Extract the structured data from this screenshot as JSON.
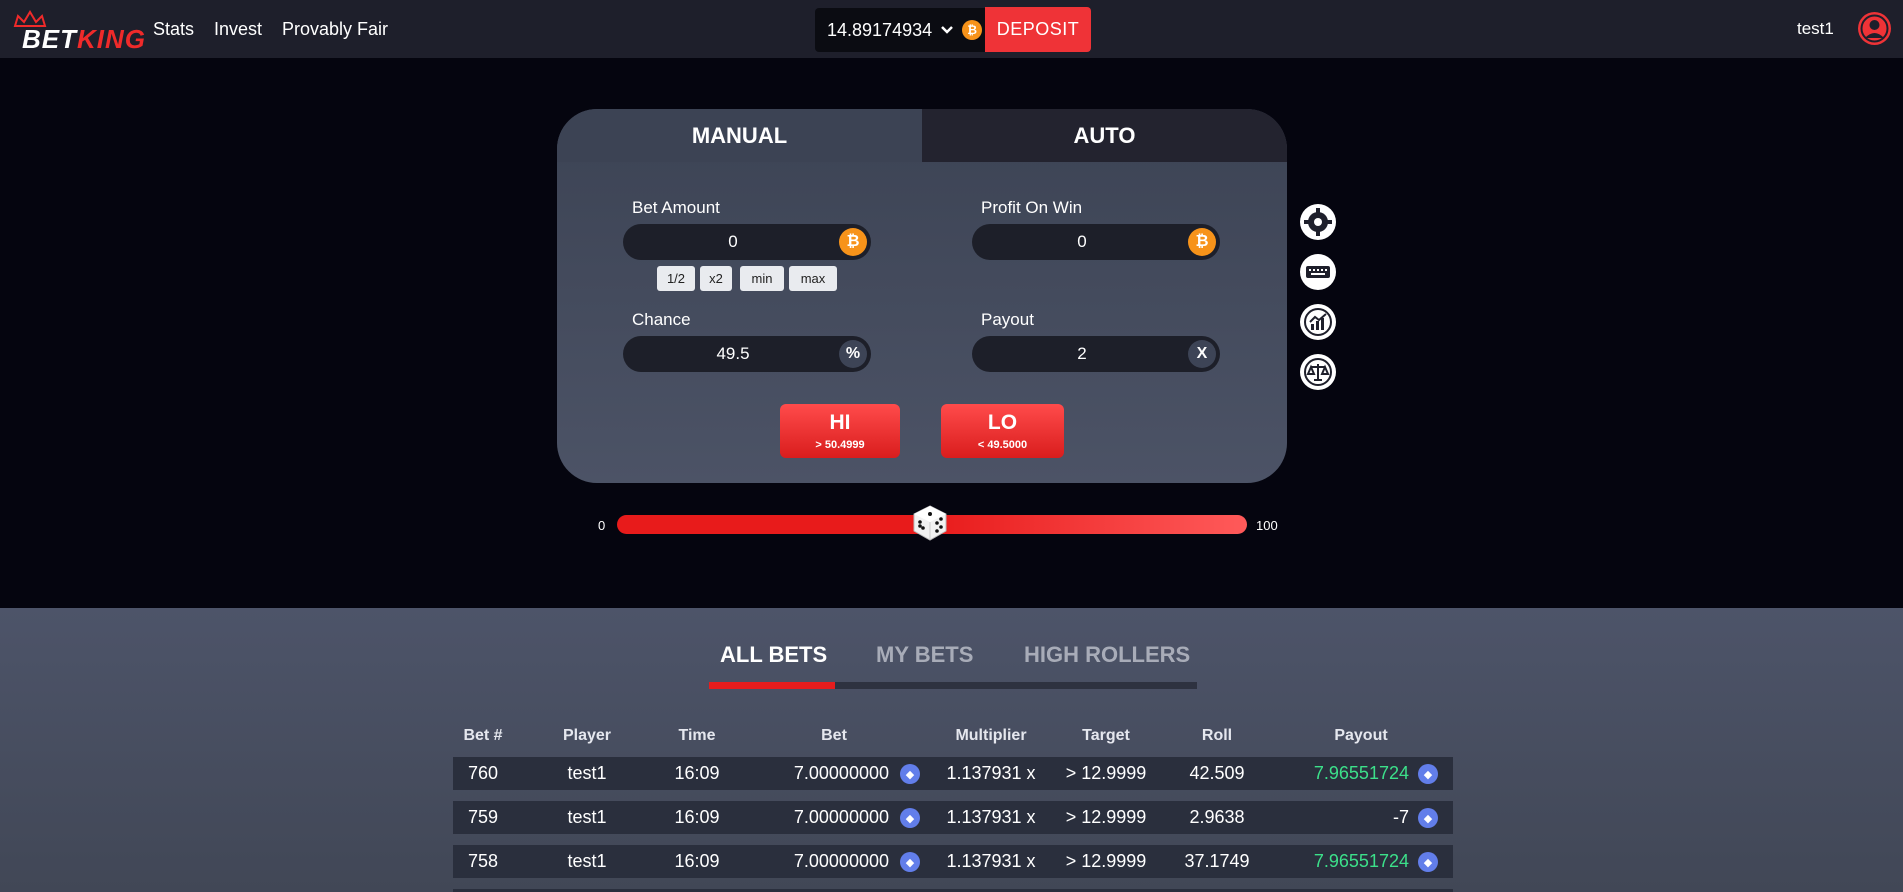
{
  "header": {
    "logo_bet": "BET",
    "logo_king": "KING",
    "nav": [
      "Stats",
      "Invest",
      "Provably Fair"
    ],
    "balance": "14.89174934",
    "currency_icon": "bitcoin-icon",
    "deposit_label": "DEPOSIT",
    "username": "test1"
  },
  "game": {
    "tabs": [
      {
        "label": "MANUAL",
        "active": true
      },
      {
        "label": "AUTO",
        "active": false
      }
    ],
    "bet_amount": {
      "label": "Bet Amount",
      "value": "0"
    },
    "profit_on_win": {
      "label": "Profit On Win",
      "value": "0"
    },
    "quick_buttons": [
      "1/2",
      "x2",
      "min",
      "max"
    ],
    "chance": {
      "label": "Chance",
      "value": "49.5",
      "suffix": "%"
    },
    "payout": {
      "label": "Payout",
      "value": "2",
      "suffix": "X"
    },
    "hi": {
      "label": "HI",
      "sub": "> 50.4999"
    },
    "lo": {
      "label": "LO",
      "sub": "< 49.5000"
    },
    "side_icons": [
      "gear-icon",
      "keyboard-icon",
      "chart-icon",
      "balance-scale-icon"
    ]
  },
  "slider": {
    "min": "0",
    "max": "100",
    "value": 50
  },
  "bets": {
    "tabs": [
      "ALL BETS",
      "MY BETS",
      "HIGH ROLLERS"
    ],
    "active_tab": "ALL BETS",
    "columns": [
      "Bet #",
      "Player",
      "Time",
      "Bet",
      "Multiplier",
      "Target",
      "Roll",
      "Payout"
    ],
    "rows": [
      {
        "id": "760",
        "player": "test1",
        "time": "16:09",
        "bet": "7.00000000",
        "multiplier": "1.137931 x",
        "target": "> 12.9999",
        "roll": "42.509",
        "payout": "7.96551724",
        "win": true
      },
      {
        "id": "759",
        "player": "test1",
        "time": "16:09",
        "bet": "7.00000000",
        "multiplier": "1.137931 x",
        "target": "> 12.9999",
        "roll": "2.9638",
        "payout": "-7",
        "win": false
      },
      {
        "id": "758",
        "player": "test1",
        "time": "16:09",
        "bet": "7.00000000",
        "multiplier": "1.137931 x",
        "target": "> 12.9999",
        "roll": "37.1749",
        "payout": "7.96551724",
        "win": true
      }
    ]
  },
  "colors": {
    "accent": "#ef3337",
    "win": "#3ce08a",
    "btc": "#f7931a",
    "eth": "#627eea"
  }
}
